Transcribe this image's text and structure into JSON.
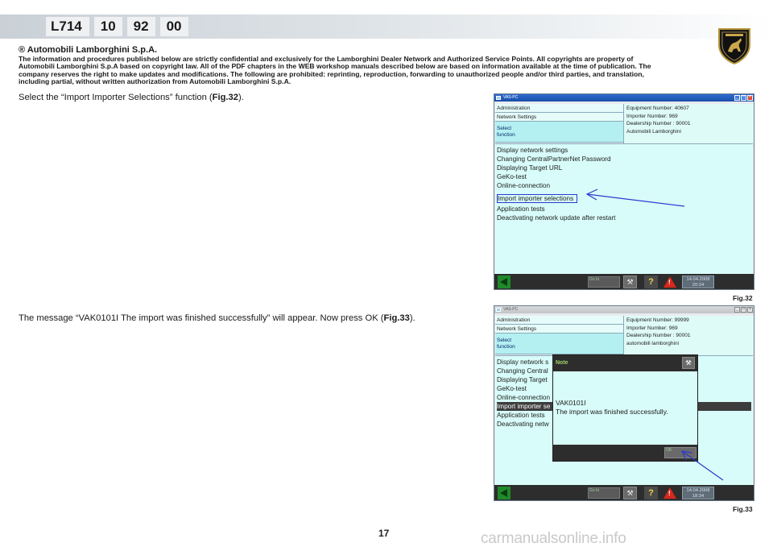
{
  "header": {
    "codes": [
      "L714",
      "10",
      "92",
      "00"
    ]
  },
  "legal": {
    "company": "® Automobili Lamborghini S.p.A.",
    "text": "The information and procedures published below are strictly confidential and exclusively for the Lamborghini Dealer Network and Authorized Service Points. All copyrights are property of Automobili Lamborghini S.p.A based on copyright law. All of the PDF chapters in the WEB workshop manuals described below are based on information available at the time of publication. The company reserves the right to make updates and modifications. The following are prohibited: reprinting, reproduction, forwarding to unauthorized people and/or third parties, and translation, including partial, without written authorization from Automobili Lamborghini S.p.A."
  },
  "para1": {
    "text_before": "Select the “Import Importer Selections” function (",
    "fig": "Fig.32",
    "text_after": ")."
  },
  "para2": {
    "text_before": "The message “VAK0101I The import was finished successfully” will appear. Now press OK (",
    "fig": "Fig.33",
    "text_after": ")."
  },
  "fig32": {
    "title": "VAS-PC",
    "menu": [
      "Administration",
      "Network Settings"
    ],
    "menu_selected": [
      "Select",
      "function"
    ],
    "info": [
      "Equipment Number:   40607",
      "Importer Number:   969",
      "Dealership Number :   90001",
      "Automobili Lamborghini"
    ],
    "items": [
      "Display network settings",
      "Changing CentralPartnerNet Password",
      "Displaying Target URL",
      "GeKo-test",
      "Online-connection",
      "Import importer selections",
      "Application tests",
      "Deactivating network update after restart"
    ],
    "goto": "Go to",
    "date": "14.04.2008",
    "time": "20:24",
    "label": "Fig.32"
  },
  "fig33": {
    "title": "VAS-PC",
    "menu": [
      "Administration",
      "Network Settings"
    ],
    "menu_selected": [
      "Select",
      "function"
    ],
    "info": [
      "Equipment Number:   99999",
      "Importer Number:   969",
      "Dealership Number :   90001",
      "automobili lamborghini"
    ],
    "items": [
      "Display network s",
      "Changing Central",
      "Displaying Target",
      "GeKo-test",
      "Online-connection",
      "Import importer se",
      "Application tests",
      "Deactivating netw"
    ],
    "note_title": "Note",
    "note_code": "VAK0101I",
    "note_message": "The import was finished successfully.",
    "ok": "OK",
    "goto": "Go to",
    "date": "14.04.2008",
    "time": "18:34",
    "label": "Fig.33"
  },
  "page_number": "17",
  "watermark": "carmanualsonline.info",
  "icons": {
    "logo": "lamborghini-bull-shield-icon",
    "back": "back-arrow-icon",
    "tool": "wrench-tool-icon",
    "help": "help-question-icon",
    "warning": "warning-triangle-icon"
  }
}
